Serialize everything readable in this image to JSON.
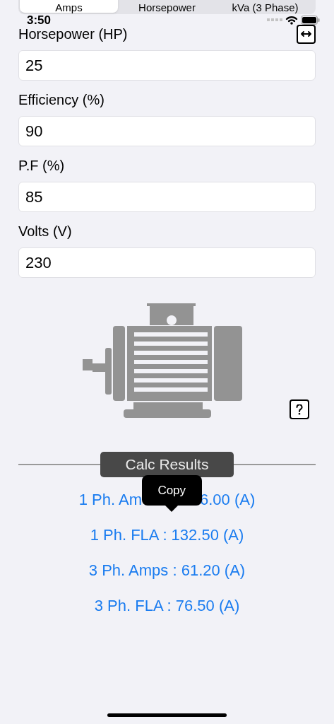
{
  "tabs": [
    {
      "label": "Amps",
      "selected": true
    },
    {
      "label": "Horsepower",
      "selected": false
    },
    {
      "label": "kVa (3 Phase)",
      "selected": false
    }
  ],
  "status_bar": {
    "time": "3:50"
  },
  "fields": [
    {
      "label": "Horsepower (HP)",
      "value": "25"
    },
    {
      "label": "Efficiency (%)",
      "value": "90"
    },
    {
      "label": "P.F (%)",
      "value": "85"
    },
    {
      "label": "Volts (V)",
      "value": "230"
    }
  ],
  "results_heading": "Calc Results",
  "tooltip": "Copy",
  "results": [
    {
      "kind": "covered",
      "left": "1 Ph. Am",
      "right": "6.00 (A)"
    },
    {
      "kind": "plain",
      "text": "1 Ph. FLA : 132.50 (A)"
    },
    {
      "kind": "plain",
      "text": "3 Ph. Amps : 61.20 (A)"
    },
    {
      "kind": "plain",
      "text": "3 Ph. FLA : 76.50 (A)"
    }
  ]
}
